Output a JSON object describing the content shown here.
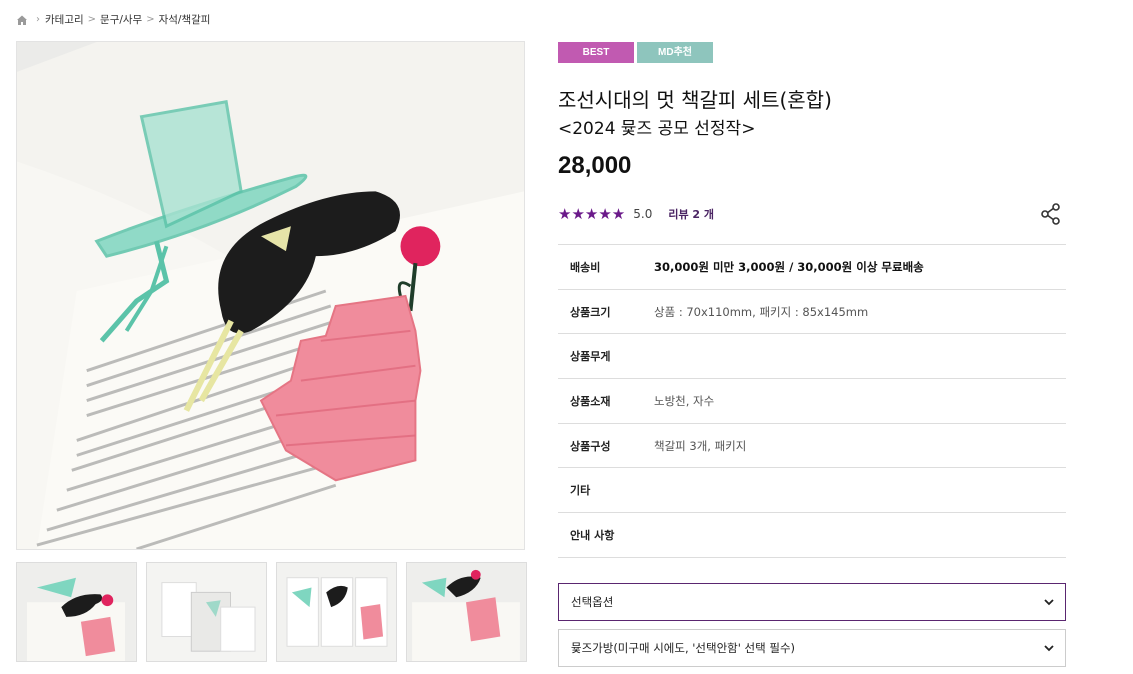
{
  "breadcrumb": {
    "items": [
      "카테고리",
      "문구/사무",
      "자석/책갈피"
    ],
    "separator": ">"
  },
  "badges": {
    "best": "BEST",
    "md": "MD추천"
  },
  "product": {
    "title": "조선시대의 멋 책갈피 세트(혼합)",
    "subtitle": "<2024 뮻즈 공모 선정작>",
    "price": "28,000",
    "stars": "★★★★★",
    "rating": "5.0",
    "review_link": "리뷰 2 개"
  },
  "info": [
    {
      "label": "배송비",
      "value": "30,000원 미만 3,000원 / 30,000원 이상 무료배송"
    },
    {
      "label": "상품크기",
      "value": "상품 : 70x110mm, 패키지 : 85x145mm"
    },
    {
      "label": "상품무게",
      "value": ""
    },
    {
      "label": "상품소재",
      "value": "노방천, 자수"
    },
    {
      "label": "상품구성",
      "value": "책갈피 3개, 패키지"
    },
    {
      "label": "기타",
      "value": ""
    },
    {
      "label": "안내 사항",
      "value": ""
    }
  ],
  "selects": {
    "option": "선택옵션",
    "bag": "뮻즈가방(미구매 시에도, '선택안함' 선택 필수)"
  },
  "colors": {
    "best_badge": "#c15ab1",
    "md_badge": "#8ec5bd",
    "stars": "#6b1a8a",
    "accent_border": "#5a2670"
  },
  "icons": {
    "home": "home-icon",
    "share": "share-icon",
    "chevron": "chevron-down-icon"
  }
}
